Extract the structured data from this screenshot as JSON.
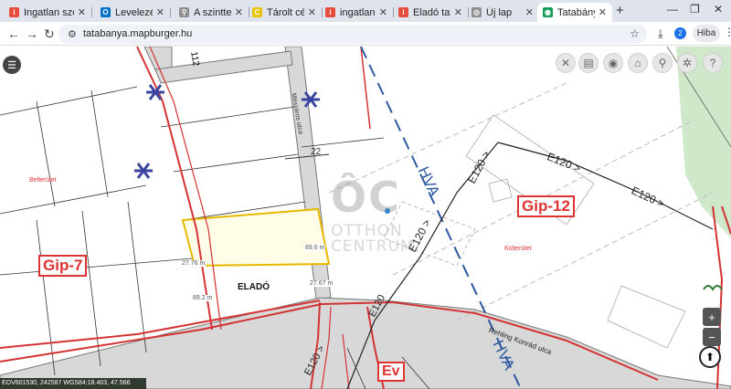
{
  "browser": {
    "tabs": [
      {
        "label": "Ingatlan szen",
        "fav_color": "#e74c3c",
        "fav_char": "i"
      },
      {
        "label": "Levelezés – I",
        "fav_color": "#0072c6",
        "fav_char": "O"
      },
      {
        "label": "A szintterület",
        "fav_color": "#8e8e8e",
        "fav_char": "⚲"
      },
      {
        "label": "Tárolt cégkiv",
        "fav_color": "#e8c400",
        "fav_char": "C"
      },
      {
        "label": "ingatlan.com",
        "fav_color": "#e74c3c",
        "fav_char": "i"
      },
      {
        "label": "Eladó tatabá",
        "fav_color": "#e74c3c",
        "fav_char": "i"
      },
      {
        "label": "Új lap",
        "fav_color": "#8e8e8e",
        "fav_char": "◎"
      },
      {
        "label": "Tatabánya té",
        "fav_color": "#0f9d58",
        "fav_char": "◉"
      }
    ],
    "new_tab": "+",
    "url": "tatabanya.mapburger.hu",
    "profile_badge": "2",
    "error_button": "Hiba",
    "colors": {
      "accent": "#1a73e8",
      "tab_bar": "#dfe3eb"
    }
  },
  "map": {
    "labels": {
      "street_meszaros": "Mészáros utca",
      "street_rehling": "Rehling Konrád utca",
      "parcel_number": "112",
      "belterulet": "Belterület",
      "kulterulet": "Külterület",
      "zone_gip7": "Gip-7",
      "zone_gip12": "Gip-12",
      "zone_ev": "Ev",
      "hva1": "HVA",
      "hva2": "HVA",
      "road_e120_a": "E120 >",
      "road_e120_b": "E120 >",
      "road_e120_c": "E120 >",
      "road_e120_d": "E120 >",
      "road_e120_e": "E120",
      "road_e120_f": "E120 >",
      "dim_22": "22",
      "for_sale": "ELADÓ",
      "meas_top": "27.76 m",
      "meas_right_top": "89.6 m",
      "meas_left": "89.2 m",
      "meas_right": "27.67 m"
    },
    "watermark": {
      "logo": "ÔC",
      "line1": "OTTHON",
      "line2": "CENTRUM"
    },
    "controls": {
      "menu_icon": "hamburger-icon",
      "tool_icons": [
        "close-icon",
        "layers-icon",
        "eye-icon",
        "home-icon",
        "search-icon",
        "settings-icon",
        "help-icon"
      ],
      "zoom_in": "+",
      "zoom_out": "−",
      "compass": "compass-icon"
    },
    "status": "EOV601530, 242587    WGS84:18.403, 47.566",
    "colors": {
      "zone_line": "#d33333",
      "hva_line": "#2c5aa0",
      "parcel_fill": "#fffde7",
      "parcel_border": "#e6b800",
      "green_area": "#cfe8c9"
    }
  }
}
